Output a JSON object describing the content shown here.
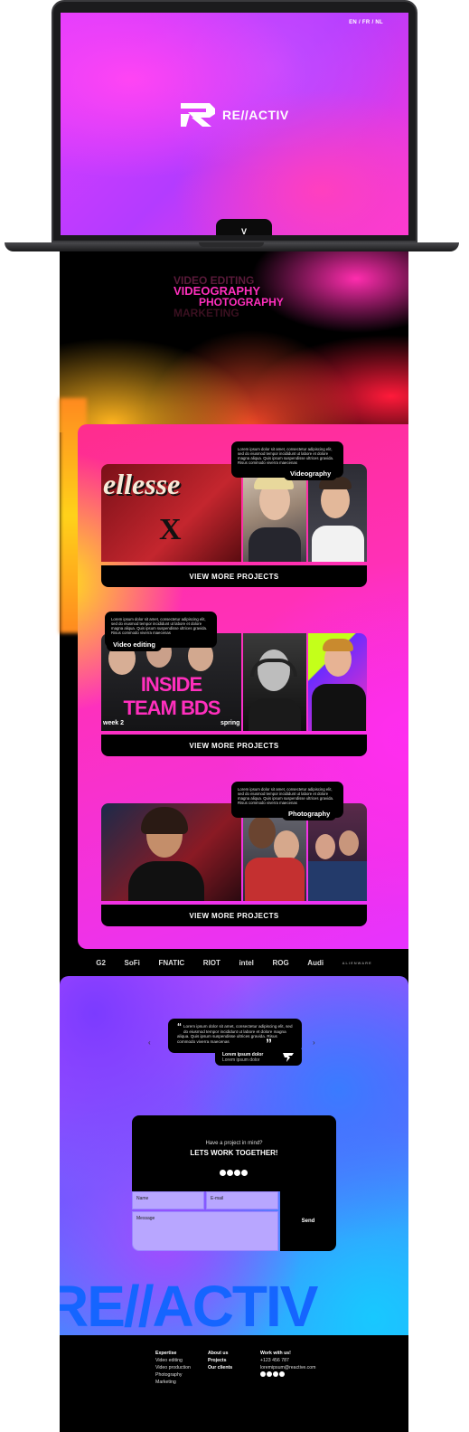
{
  "hero": {
    "languages": "EN / FR / NL",
    "brand": "RE//ACTIV",
    "scroll_glyph": "V"
  },
  "services": [
    "VIDEO EDITING",
    "VIDEOGRAPHY",
    "PHOTOGRAPHY",
    "MARKETING"
  ],
  "projects": [
    {
      "category": "Videography",
      "tip": "Lorem ipsum dolor sit amet, consectetur adipiscing elit, sed do eiusmod tempor incididunt ut labore et dolore magna aliqua. Quis ipsum suspendisse ultrices gravida. Risus commodo viverra maecenas",
      "button": "VIEW MORE PROJECTS",
      "photo_text": [
        "ellesse",
        "X"
      ]
    },
    {
      "category": "Video editing",
      "tip": "Lorem ipsum dolor sit amet, consectetur adipiscing elit, sed do eiusmod tempor incididunt ut labore et dolore magna aliqua. Quis ipsum suspendisse ultrices gravida. Risus commodo viverra maecenas",
      "button": "VIEW MORE PROJECTS",
      "photo_text": [
        "INSIDE",
        "TEAM BDS",
        "week 2",
        "spring"
      ]
    },
    {
      "category": "Photography",
      "tip": "Lorem ipsum dolor sit amet, consectetur adipiscing elit, sed do eiusmod tempor incididunt ut labore et dolore magna aliqua. Quis ipsum suspendisse ultrices gravida. Risus commodo viverra maecenas",
      "button": "VIEW MORE PROJECTS"
    }
  ],
  "partners": [
    "G2",
    "SoFi",
    "FNATIC",
    "RIOT",
    "intel",
    "ROG",
    "Audi",
    "ALIENWARE"
  ],
  "testimonial": {
    "text": "Lorem ipsum dolor sit amet, consectetur adipiscing elit, sed do eiusmod tempor incididunt ut labore et dolore magna aliqua. Quis ipsum suspendisse ultrices gravida. Risus commodo viverra maecenas",
    "author": "Lorem ipsum dolor",
    "role": "Lorem ipsum dolor",
    "prev": "‹",
    "next": "›"
  },
  "contact": {
    "question": "Have a project in mind?",
    "title": "LETS WORK TOGETHER!",
    "name_placeholder": "Name",
    "email_placeholder": "E-mail",
    "message_placeholder": "Message",
    "send": "Send"
  },
  "big_brand": "RE//ACTIV",
  "footer": {
    "expertise": {
      "heading": "Expertise",
      "items": [
        "Video editing",
        "Video production",
        "Photography",
        "Marketing"
      ]
    },
    "links": [
      "About us",
      "Projects",
      "Our clients"
    ],
    "work": {
      "heading": "Work with us!",
      "phone": "+123 456 787",
      "email": "loremipsum@reactive.com"
    }
  },
  "colors": {
    "pink": "#ff30b8",
    "blue": "#1565ff",
    "magenta": "#e13cff"
  }
}
